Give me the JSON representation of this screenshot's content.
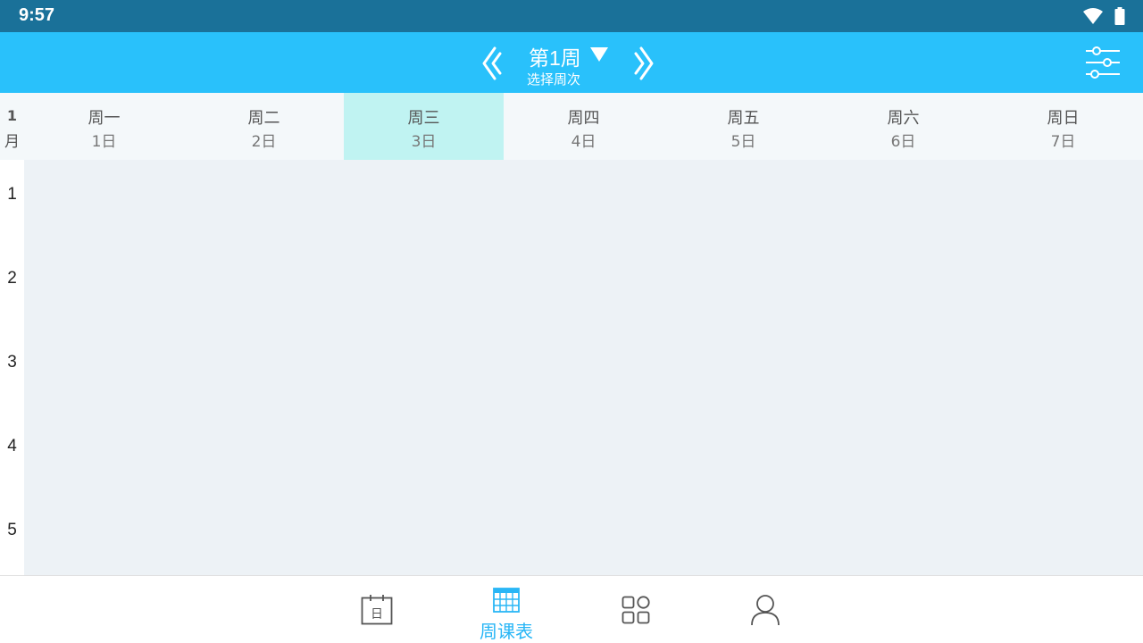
{
  "status_bar": {
    "time": "9:57",
    "icons": [
      "wifi-icon",
      "battery-icon"
    ]
  },
  "header": {
    "week_title": "第1周",
    "week_subtitle": "选择周次",
    "prev_icon": "chevron-left-icon",
    "next_icon": "chevron-right-icon",
    "caret_icon": "triangle-down-icon",
    "settings_icon": "sliders-icon"
  },
  "calendar": {
    "month_num": "1",
    "month_unit": "月",
    "days": [
      {
        "name": "周一",
        "date": "1日",
        "active": false
      },
      {
        "name": "周二",
        "date": "2日",
        "active": false
      },
      {
        "name": "周三",
        "date": "3日",
        "active": true
      },
      {
        "name": "周四",
        "date": "4日",
        "active": false
      },
      {
        "name": "周五",
        "date": "5日",
        "active": false
      },
      {
        "name": "周六",
        "date": "6日",
        "active": false
      },
      {
        "name": "周日",
        "date": "7日",
        "active": false
      }
    ],
    "periods": [
      "1",
      "2",
      "3",
      "4",
      "5"
    ]
  },
  "bottom_nav": {
    "tabs": [
      {
        "icon": "calendar-day-icon",
        "label": "",
        "active": false,
        "day_glyph": "日"
      },
      {
        "icon": "grid-calendar-icon",
        "label": "周课表",
        "active": true
      },
      {
        "icon": "apps-icon",
        "label": "",
        "active": false
      },
      {
        "icon": "user-icon",
        "label": "",
        "active": false
      }
    ]
  },
  "colors": {
    "status_bar": "#1a7199",
    "header": "#29c1fb",
    "active_day": "#c0f3f2",
    "grid_bg": "#edf2f6",
    "accent": "#29b6f6",
    "icon_gray": "#555555"
  }
}
